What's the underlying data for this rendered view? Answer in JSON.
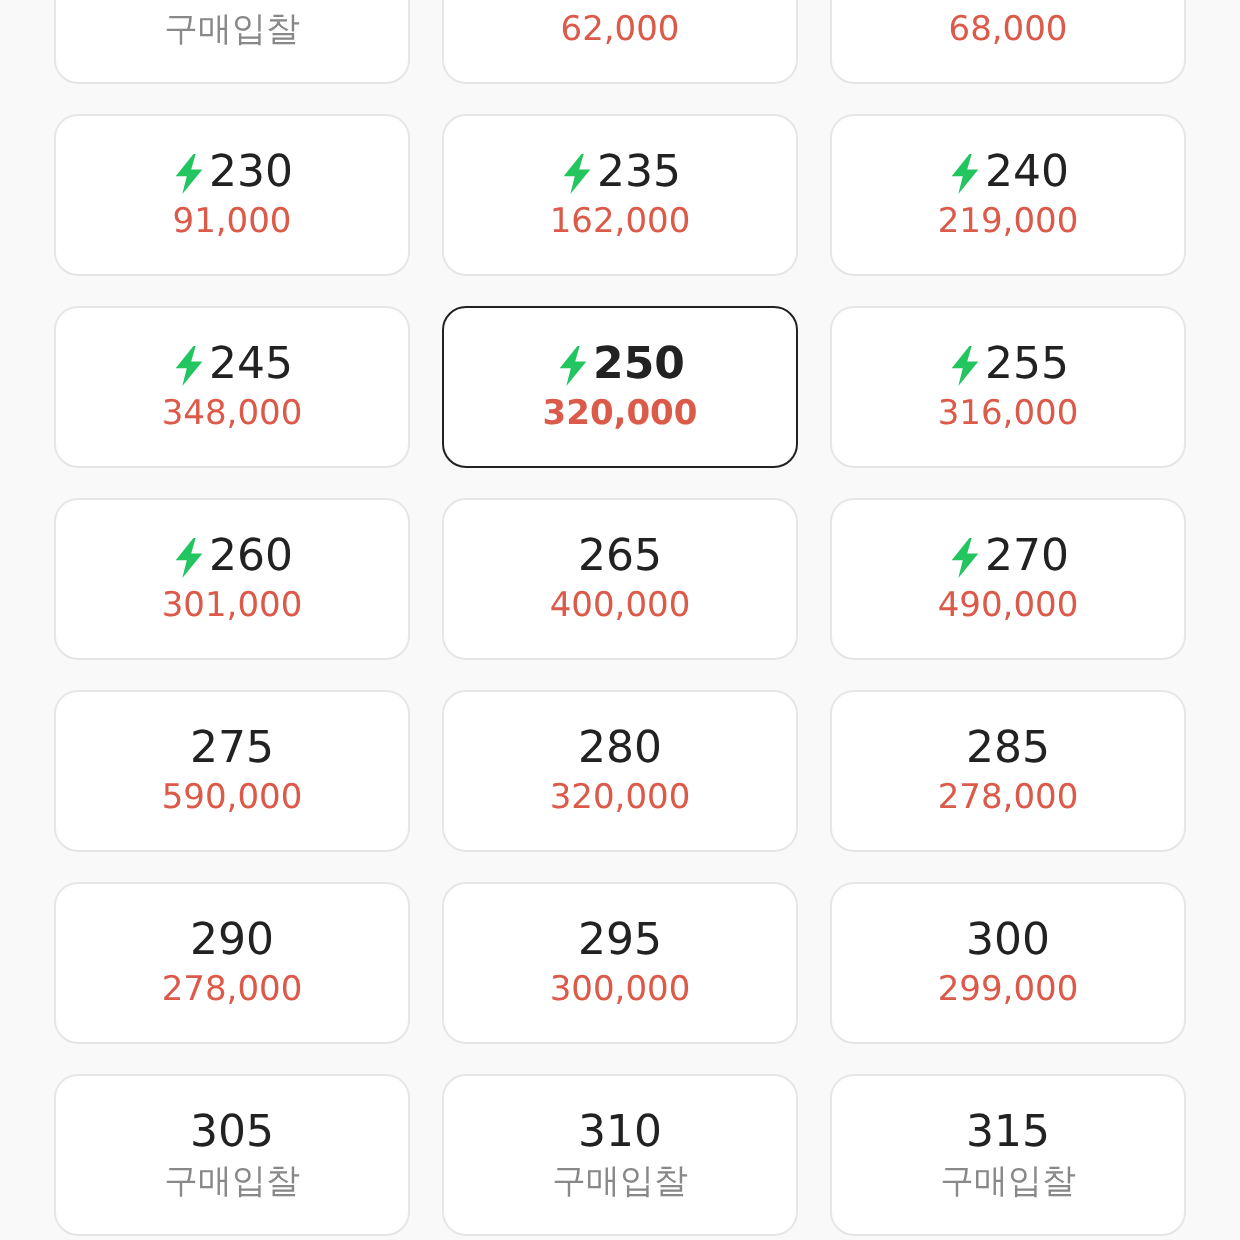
{
  "sizes": [
    {
      "price": "구매입찰",
      "kind": "bid",
      "selected": false
    },
    {
      "price": "62,000",
      "kind": "price",
      "selected": false
    },
    {
      "price": "68,000",
      "kind": "price",
      "selected": false
    },
    {
      "size": "230",
      "price": "91,000",
      "kind": "price",
      "fast": true,
      "selected": false
    },
    {
      "size": "235",
      "price": "162,000",
      "kind": "price",
      "fast": true,
      "selected": false
    },
    {
      "size": "240",
      "price": "219,000",
      "kind": "price",
      "fast": true,
      "selected": false
    },
    {
      "size": "245",
      "price": "348,000",
      "kind": "price",
      "fast": true,
      "selected": false
    },
    {
      "size": "250",
      "price": "320,000",
      "kind": "price",
      "fast": true,
      "selected": true
    },
    {
      "size": "255",
      "price": "316,000",
      "kind": "price",
      "fast": true,
      "selected": false
    },
    {
      "size": "260",
      "price": "301,000",
      "kind": "price",
      "fast": true,
      "selected": false
    },
    {
      "size": "265",
      "price": "400,000",
      "kind": "price",
      "fast": false,
      "selected": false
    },
    {
      "size": "270",
      "price": "490,000",
      "kind": "price",
      "fast": true,
      "selected": false
    },
    {
      "size": "275",
      "price": "590,000",
      "kind": "price",
      "fast": false,
      "selected": false
    },
    {
      "size": "280",
      "price": "320,000",
      "kind": "price",
      "fast": false,
      "selected": false
    },
    {
      "size": "285",
      "price": "278,000",
      "kind": "price",
      "fast": false,
      "selected": false
    },
    {
      "size": "290",
      "price": "278,000",
      "kind": "price",
      "fast": false,
      "selected": false
    },
    {
      "size": "295",
      "price": "300,000",
      "kind": "price",
      "fast": false,
      "selected": false
    },
    {
      "size": "300",
      "price": "299,000",
      "kind": "price",
      "fast": false,
      "selected": false
    },
    {
      "size": "305",
      "price": "구매입찰",
      "kind": "bid",
      "fast": false,
      "selected": false
    },
    {
      "size": "310",
      "price": "구매입찰",
      "kind": "bid",
      "fast": false,
      "selected": false
    },
    {
      "size": "315",
      "price": "구매입찰",
      "kind": "bid",
      "fast": false,
      "selected": false
    }
  ]
}
